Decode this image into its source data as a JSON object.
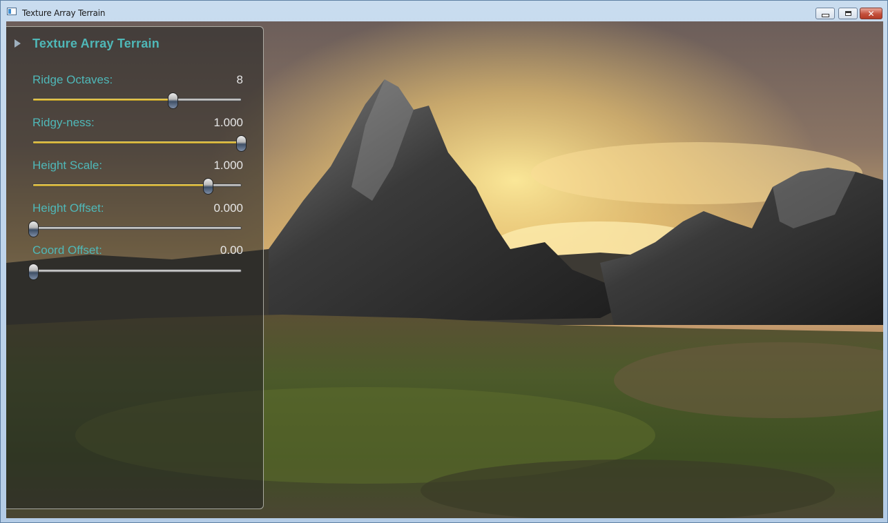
{
  "window": {
    "title": "Texture Array Terrain",
    "controls": [
      "minimize",
      "maximize",
      "close"
    ]
  },
  "panel": {
    "title": "Texture Array Terrain",
    "expand_icon": "triangle-right-icon",
    "sliders": [
      {
        "label": "Ridge Octaves:",
        "value": "8",
        "position": 0.67
      },
      {
        "label": "Ridgy-ness:",
        "value": "1.000",
        "position": 1.0
      },
      {
        "label": "Height Scale:",
        "value": "1.000",
        "position": 0.84
      },
      {
        "label": "Height Offset:",
        "value": "0.000",
        "position": 0.0
      },
      {
        "label": "Coord Offset:",
        "value": "0.00",
        "position": 0.0
      }
    ]
  },
  "colors": {
    "label": "#4fb8b8",
    "value": "#e6e6e6",
    "slider_fill": "#d8b22a"
  }
}
